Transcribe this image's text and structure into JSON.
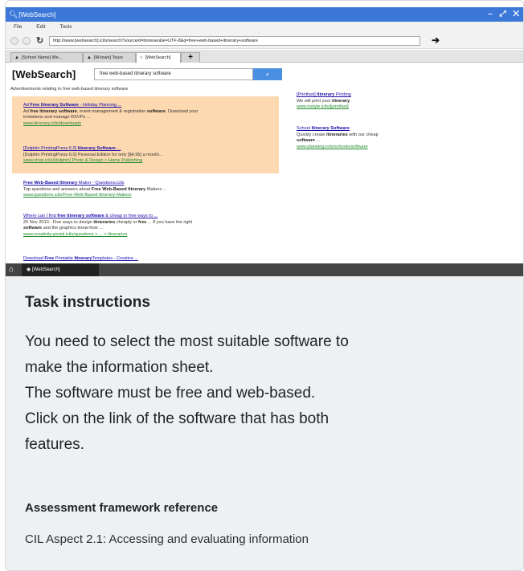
{
  "window": {
    "title": "[WebSearch]",
    "controls": "– ⤢ ✕"
  },
  "menu": [
    "File",
    "Edit",
    "Tools"
  ],
  "address": {
    "url": "http://www.[websearch].icils/search?sourceid=browser&ie=UTF-8&q=free+web-based+itinerary+software"
  },
  "tabs": [
    {
      "label": "[School Name] We..."
    },
    {
      "label": "[M-town] Tours"
    },
    {
      "label": "[WebSearch]"
    }
  ],
  "page": {
    "logo": "[WebSearch]",
    "search_value": "free web-based itinerary software",
    "ads_heading": "Advertisements relating to free web-based itinerary software",
    "ads": [
      {
        "title_parts": [
          "Ad ",
          "Free Itinerary Software",
          " - Holiday Planning ..."
        ],
        "desc_lines": [
          [
            "Ad ",
            "free itinerary software",
            ", event management & registration ",
            "software",
            ". Download your"
          ],
          [
            "invitations and manage RSVPs ..."
          ]
        ],
        "url": "www.itinerary.icils/downloads"
      },
      {
        "title_parts": [
          "[Dolphin PrintingPress 6.0] ",
          "Itinerary Software",
          " ..."
        ],
        "desc_lines": [
          [
            "[Dolphin PrintingPress 6.0] Personal Edition for only [$4.95] a month..."
          ]
        ],
        "url": "www.shop.icils/[dolphin] Photo & Design > Home Publishing"
      }
    ],
    "side_ads": [
      {
        "title_parts": [
          "[Printfast] ",
          "Itinerary",
          " Printing"
        ],
        "desc": [
          "We will print your ",
          "itinerary",
          "."
        ],
        "url": "www.instyle.icils/[printfast]"
      },
      {
        "title_parts": [
          "School ",
          "Itinerary Software"
        ],
        "desc1": [
          "Quickly create ",
          "itineraries",
          " with our cheap"
        ],
        "desc2": [
          "software",
          " ..."
        ],
        "url": "www.planning.icils/schools/software"
      }
    ],
    "results": [
      {
        "title_parts": [
          "Free Web-Based Itinerary",
          " Maker - Questions.icils"
        ],
        "desc": [
          "Top questions and answers about ",
          "Free Web-Based Itinerary",
          " Makers ..."
        ],
        "url": "www.questions.icils/Free-Web-Based-Itinerary-Makers"
      },
      {
        "title_parts": [
          "Where can I find ",
          "free itinerary software",
          " & cheap or free ways to ..."
        ],
        "desc1": [
          "25 Nov 2010 - Five ways to design ",
          "itineraries",
          " cheaply or ",
          "free",
          " ... If you have the right"
        ],
        "desc2": [
          "software",
          " and the graphics know-how ..."
        ],
        "url": "www.creativity-portal.icils/questions > ... > itineraries"
      },
      {
        "title_parts": [
          "Download ",
          "Free",
          " Printable ",
          "Itinerary",
          "Templates - Creative ..."
        ]
      }
    ]
  },
  "taskbar": {
    "item": "[WebSearch]"
  },
  "instructions": {
    "heading": "Task instructions",
    "lines": [
      "You need to select the most suitable software to",
      "make the information sheet.",
      "The software must be free and web-based.",
      "Click on the link of the software that has both",
      "features."
    ],
    "framework_heading": "Assessment framework reference",
    "framework_text": "CIL Aspect 2.1: Accessing and evaluating information"
  }
}
